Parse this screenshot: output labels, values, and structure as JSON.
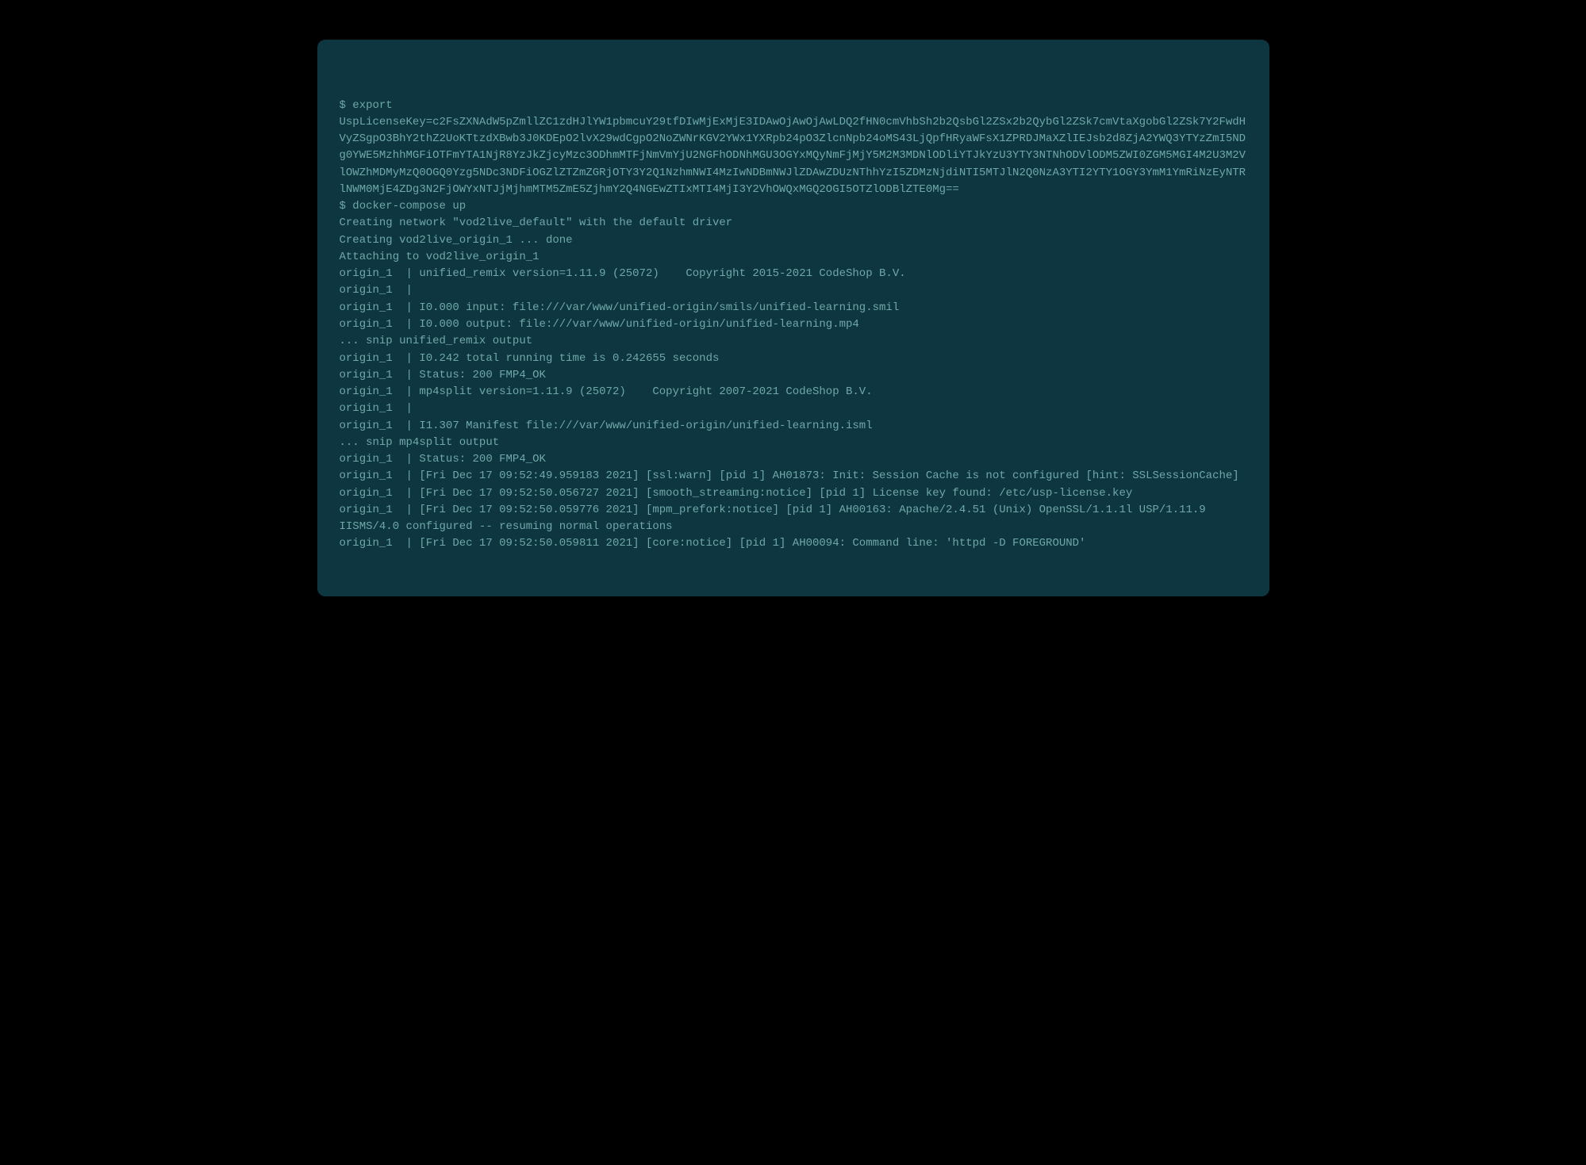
{
  "terminal": {
    "lines": [
      "$ export UspLicenseKey=c2FsZXNAdW5pZmllZC1zdHJlYW1pbmcuY29tfDIwMjExMjE3IDAwOjAwOjAwLDQ2fHN0cmVhbSh2b2QsbGl2ZSx2b2QybGl2ZSk7cmVtaXgobGl2ZSk7Y2FwdHVyZSgpO3BhY2thZ2UoKTtzdXBwb3J0KDEpO2lvX29wdCgpO2NoZWNrKGV2YWx1YXRpb24pO3ZlcnNpb24oMS43LjQpfHRyaWFsX1ZPRDJMaXZlIEJsb2d8ZjA2YWQ3YTYzZmI5NDg0YWE5MzhhMGFiOTFmYTA1NjR8YzJkZjcyMzc3ODhmMTFjNmVmYjU2NGFhODNhMGU3OGYxMQyNmFjMjY5M2M3MDNlODliYTJkYzU3YTY3NTNhODVlODM5ZWI0ZGM5MGI4M2U3M2VlOWZhMDMyMzQ0OGQ0Yzg5NDc3NDFiOGZlZTZmZGRjOTY3Y2Q1NzhmNWI4MzIwNDBmNWJlZDAwZDUzNThhYzI5ZDMzNjdiNTI5MTJlN2Q0NzA3YTI2YTY1OGY3YmM1YmRiNzEyNTRlNWM0MjE4ZDg3N2FjOWYxNTJjMjhmMTM5ZmE5ZjhmY2Q4NGEwZTIxMTI4MjI3Y2VhOWQxMGQ2OGI5OTZlODBlZTE0Mg==",
      "$ docker-compose up",
      "Creating network \"vod2live_default\" with the default driver",
      "Creating vod2live_origin_1 ... done",
      "Attaching to vod2live_origin_1",
      "origin_1  | unified_remix version=1.11.9 (25072)    Copyright 2015-2021 CodeShop B.V.",
      "origin_1  |",
      "origin_1  | I0.000 input: file:///var/www/unified-origin/smils/unified-learning.smil",
      "origin_1  | I0.000 output: file:///var/www/unified-origin/unified-learning.mp4",
      "... snip unified_remix output",
      "origin_1  | I0.242 total running time is 0.242655 seconds",
      "origin_1  | Status: 200 FMP4_OK",
      "origin_1  | mp4split version=1.11.9 (25072)    Copyright 2007-2021 CodeShop B.V.",
      "origin_1  |",
      "origin_1  | I1.307 Manifest file:///var/www/unified-origin/unified-learning.isml",
      "... snip mp4split output",
      "origin_1  | Status: 200 FMP4_OK",
      "origin_1  | [Fri Dec 17 09:52:49.959183 2021] [ssl:warn] [pid 1] AH01873: Init: Session Cache is not configured [hint: SSLSessionCache]",
      "origin_1  | [Fri Dec 17 09:52:50.056727 2021] [smooth_streaming:notice] [pid 1] License key found: /etc/usp-license.key",
      "origin_1  | [Fri Dec 17 09:52:50.059776 2021] [mpm_prefork:notice] [pid 1] AH00163: Apache/2.4.51 (Unix) OpenSSL/1.1.1l USP/1.11.9 IISMS/4.0 configured -- resuming normal operations",
      "origin_1  | [Fri Dec 17 09:52:50.059811 2021] [core:notice] [pid 1] AH00094: Command line: 'httpd -D FOREGROUND'"
    ]
  }
}
